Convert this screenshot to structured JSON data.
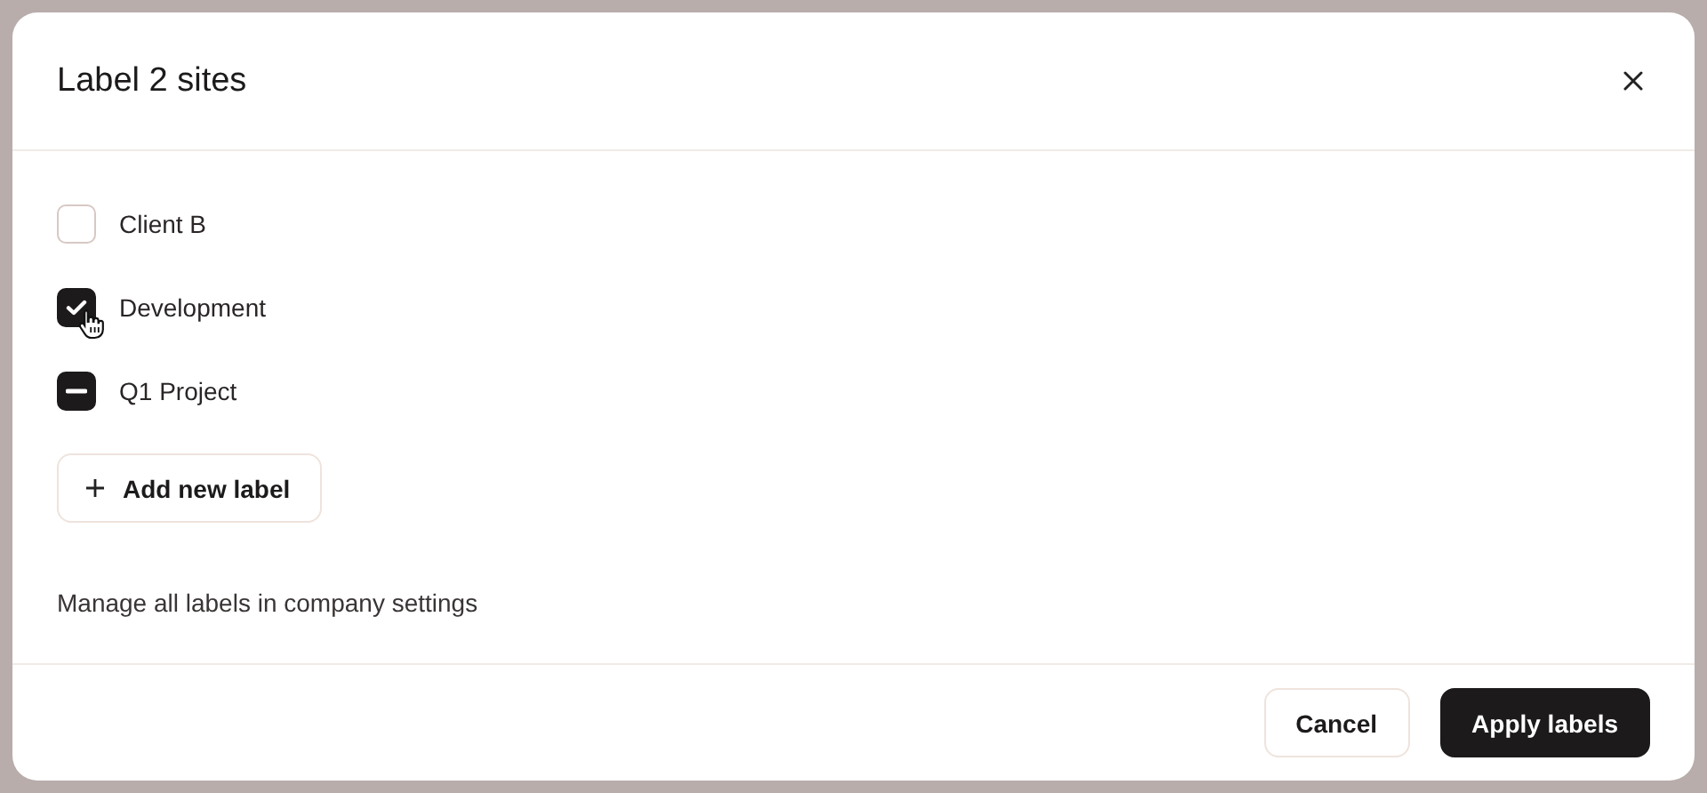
{
  "dialog": {
    "title": "Label 2 sites"
  },
  "labels": [
    {
      "name": "Client B",
      "checked": false,
      "indeterminate": false
    },
    {
      "name": "Development",
      "checked": true,
      "indeterminate": false
    },
    {
      "name": "Q1 Project",
      "checked": true,
      "indeterminate": true
    }
  ],
  "add_button": "Add new label",
  "note": "Manage all labels in company settings",
  "buttons": [
    {
      "label": "Cancel",
      "kind": "secondary"
    },
    {
      "label": "Apply labels",
      "kind": "primary"
    }
  ]
}
